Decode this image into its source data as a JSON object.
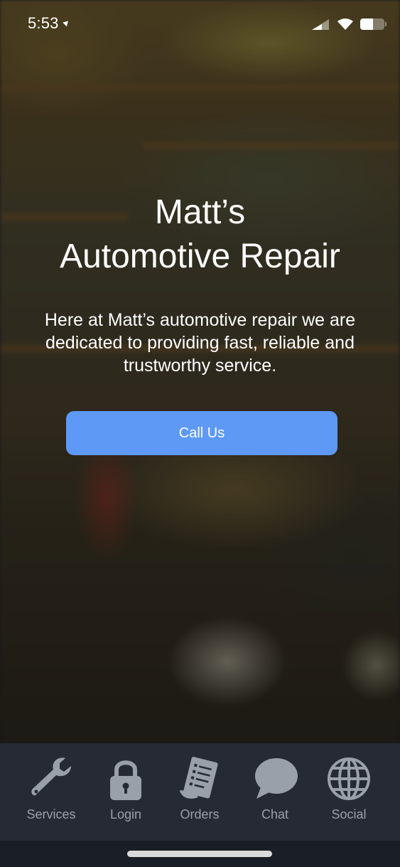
{
  "status_bar": {
    "time": "5:53"
  },
  "hero": {
    "title_line1": "Matt’s",
    "title_line2": "Automotive Repair",
    "description": "Here at Matt’s automotive repair we are dedicated to providing fast, reliable and trustworthy service.",
    "cta_label": "Call Us"
  },
  "tabs": [
    {
      "label": "Services",
      "icon": "wrench-icon"
    },
    {
      "label": "Login",
      "icon": "lock-icon"
    },
    {
      "label": "Orders",
      "icon": "receipt-icon"
    },
    {
      "label": "Chat",
      "icon": "chat-bubble-icon"
    },
    {
      "label": "Social",
      "icon": "globe-icon"
    }
  ],
  "colors": {
    "accent": "#5e99f6",
    "tabbar_bg": "#252a34",
    "tab_icon": "#9aa0a9"
  }
}
